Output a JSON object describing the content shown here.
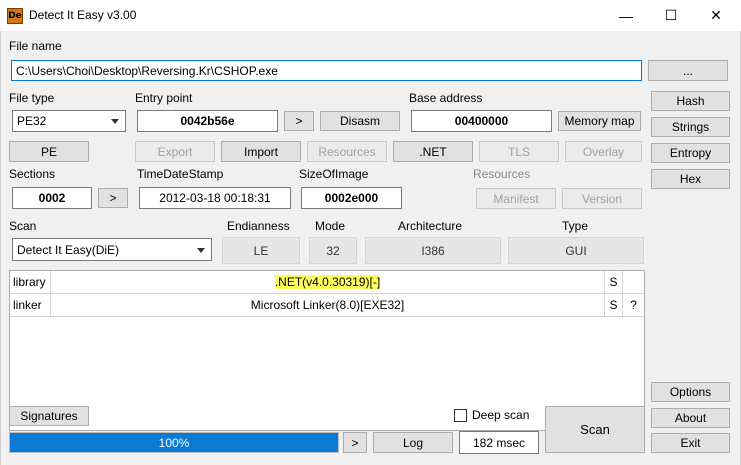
{
  "window": {
    "title": "Detect It Easy v3.00",
    "icon_text": "De",
    "controls": {
      "minimize": "—",
      "maximize": "☐",
      "close": "✕"
    }
  },
  "file": {
    "label": "File name",
    "path": "C:\\Users\\Choi\\Desktop\\Reversing.Kr\\CSHOP.exe",
    "browse_label": "..."
  },
  "header": {
    "file_type_label": "File type",
    "file_type_value": "PE32",
    "entry_point_label": "Entry point",
    "entry_point_value": "0042b56e",
    "entry_point_nav": ">",
    "disasm_label": "Disasm",
    "base_address_label": "Base address",
    "base_address_value": "00400000",
    "memory_map_label": "Memory map"
  },
  "pe_buttons": {
    "pe": "PE",
    "export": "Export",
    "import": "Import",
    "resources": "Resources",
    "dotnet": ".NET",
    "tls": "TLS",
    "overlay": "Overlay"
  },
  "sections_row": {
    "sections_label": "Sections",
    "sections_value": "0002",
    "sections_nav": ">",
    "timestamp_label": "TimeDateStamp",
    "timestamp_value": "2012-03-18 00:18:31",
    "size_label": "SizeOfImage",
    "size_value": "0002e000",
    "resources_label": "Resources",
    "manifest_label": "Manifest",
    "version_label": "Version"
  },
  "scan_row": {
    "scan_label": "Scan",
    "scan_engine": "Detect It Easy(DiE)",
    "endianness_label": "Endianness",
    "endianness_value": "LE",
    "mode_label": "Mode",
    "mode_value": "32",
    "arch_label": "Architecture",
    "arch_value": "I386",
    "type_label": "Type",
    "type_value": "GUI"
  },
  "results": [
    {
      "kind": "library",
      "name": ".NET(v4.0.30319)[-]",
      "flag": "S",
      "extra": "",
      "highlight": true
    },
    {
      "kind": "linker",
      "name": "Microsoft Linker(8.0)[EXE32]",
      "flag": "S",
      "extra": "?",
      "highlight": false
    }
  ],
  "right_panel": {
    "hash": "Hash",
    "strings": "Strings",
    "entropy": "Entropy",
    "hex": "Hex",
    "options": "Options",
    "about": "About",
    "exit": "Exit"
  },
  "bottom": {
    "signatures_label": "Signatures",
    "deep_scan_label": "Deep scan",
    "deep_scan_checked": false,
    "progress_text": "100%",
    "progress_value": 1.0,
    "progress_nav": ">",
    "log_label": "Log",
    "elapsed": "182 msec",
    "scan_button": "Scan"
  },
  "colors": {
    "accent": "#0a7ad6",
    "highlight": "#ffff5c",
    "window_bg": "#f0f0f0"
  }
}
